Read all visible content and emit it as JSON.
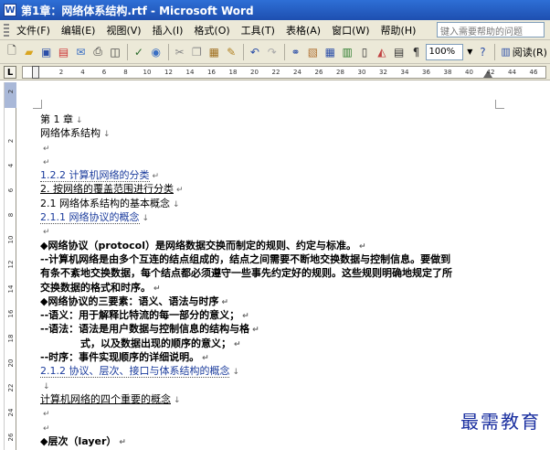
{
  "window": {
    "title": "第1章：网络体系结构.rtf - Microsoft Word",
    "app_icon": "W"
  },
  "menu": {
    "items": [
      "文件(F)",
      "编辑(E)",
      "视图(V)",
      "插入(I)",
      "格式(O)",
      "工具(T)",
      "表格(A)",
      "窗口(W)",
      "帮助(H)"
    ],
    "help_placeholder": "键入需要帮助的问题"
  },
  "toolbar": {
    "zoom": "100%",
    "read_label": "阅读(R)",
    "icons": [
      "new-icon",
      "open-icon",
      "save-icon",
      "permission-icon",
      "email-icon",
      "print-icon",
      "print-preview-icon",
      "spelling-icon",
      "research-icon",
      "cut-icon",
      "copy-icon",
      "paste-icon",
      "format-painter-icon",
      "undo-icon",
      "redo-icon",
      "hyperlink-icon",
      "tables-borders-icon",
      "insert-table-icon",
      "insert-excel-icon",
      "columns-icon",
      "drawing-icon",
      "document-map-icon",
      "show-hide-icon"
    ]
  },
  "ruler": {
    "ticks": [
      "2",
      "4",
      "6",
      "8",
      "10",
      "12",
      "14",
      "16",
      "18",
      "20",
      "22",
      "24",
      "26",
      "28",
      "30",
      "32",
      "34",
      "36",
      "38",
      "40",
      "42",
      "44",
      "46"
    ],
    "vticks": [
      "2",
      "",
      "2",
      "4",
      "6",
      "8",
      "10",
      "12",
      "14",
      "16",
      "18",
      "20",
      "22",
      "24",
      "26"
    ]
  },
  "document": {
    "lines": [
      {
        "text": "第 1 章",
        "mark": "↓"
      },
      {
        "text": "网络体系结构",
        "mark": "↓"
      },
      {
        "text": "",
        "mark": "↵"
      },
      {
        "text": "",
        "mark": "↵"
      },
      {
        "text": "1.2.2  计算机网络的分类",
        "mark": "↵",
        "style": "dotted"
      },
      {
        "text": "2.  按网络的覆盖范围进行分类",
        "mark": "↵",
        "style": "solid"
      },
      {
        "text": "2.1    网络体系结构的基本概念",
        "mark": "↓"
      },
      {
        "text": "2.1.1    网络协议的概念",
        "mark": "↓",
        "style": "dotted"
      },
      {
        "text": "",
        "mark": "↵"
      },
      {
        "text": "◆网络协议（protocol）是网络数据交换而制定的规则、约定与标准。",
        "mark": "↵",
        "bold": true
      },
      {
        "text": "--计算机网络是由多个互连的结点组成的，结点之间需要不断地交换数据与控制信息。要做到",
        "bold": true
      },
      {
        "text": "有条不紊地交换数据，每个结点都必须遵守一些事先约定好的规则。这些规则明确地规定了所",
        "bold": true
      },
      {
        "text": "交换数据的格式和时序。",
        "mark": "↵",
        "bold": true
      },
      {
        "text": "◆网络协议的三要素：语义、语法与时序",
        "mark": "↵",
        "bold": true
      },
      {
        "text": "--语义：用于解释比特流的每一部分的意义；",
        "mark": "↵",
        "bold": true
      },
      {
        "text": "--语法：语法是用户数据与控制信息的结构与格",
        "mark": "↵",
        "bold": true
      },
      {
        "text": "式，以及数据出现的顺序的意义；",
        "mark": "↵",
        "bold": true,
        "indent": true
      },
      {
        "text": "--时序：事件实现顺序的详细说明。",
        "mark": "↵",
        "bold": true
      },
      {
        "text": "2.1.2    协议、层次、接口与体系结构的概念",
        "mark": "↓",
        "style": "dotted"
      },
      {
        "text": "",
        "mark": "↓"
      },
      {
        "text": "计算机网络的四个重要的概念",
        "mark": "↓",
        "style": "solid"
      },
      {
        "text": "",
        "mark": "↵"
      },
      {
        "text": "",
        "mark": "↵"
      },
      {
        "text": "◆层次（layer）",
        "mark": "↵",
        "bold": true
      }
    ]
  },
  "watermark": "最需教育"
}
